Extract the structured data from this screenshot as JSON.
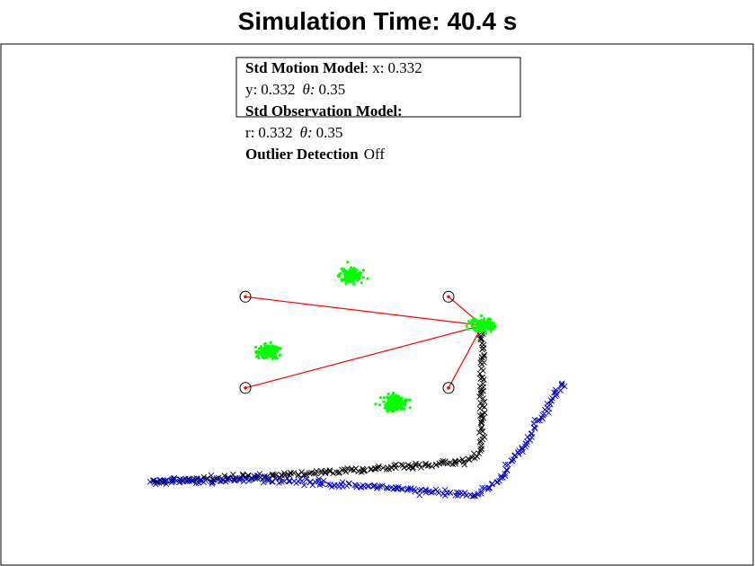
{
  "title": "Simulation Time: 40.4 s",
  "legend": {
    "motion_label": "Std Motion Model",
    "motion_x_prefix": ": x:",
    "motion_x": "0.332",
    "motion_y_prefix": "y:",
    "motion_y": "0.332",
    "motion_theta_prefix": "θ:",
    "motion_theta": "0.35",
    "observation_label": "Std Observation Model:",
    "obs_r_prefix": "r:",
    "obs_r": "0.332",
    "obs_theta_prefix": "θ:",
    "obs_theta": "0.35",
    "outlier_label": "Outlier Detection",
    "outlier_value": "Off"
  },
  "colors": {
    "estimate_path": "#000000",
    "true_path": "#0000cc",
    "particles": "#00ff00",
    "observation_lines": "#ff0000",
    "landmark_circle": "#000000",
    "landmark_dot": "#ff0000",
    "frame": "#000000"
  },
  "chart_data": {
    "type": "scatter",
    "title": "Simulation Time: 40.4 s",
    "xlabel": "",
    "ylabel": "",
    "xlim": [
      0,
      100
    ],
    "ylim": [
      0,
      100
    ],
    "grid": false,
    "legend_placement": "top-center",
    "landmarks": [
      {
        "x": 32.5,
        "y": 51.5
      },
      {
        "x": 59.5,
        "y": 51.5
      },
      {
        "x": 32.5,
        "y": 34.0
      },
      {
        "x": 59.5,
        "y": 34.0
      }
    ],
    "robot": {
      "x": 64.0,
      "y": 46.0
    },
    "particle_clusters": [
      {
        "x": 46.5,
        "y": 55.5
      },
      {
        "x": 64.0,
        "y": 46.0
      },
      {
        "x": 35.5,
        "y": 41.0
      },
      {
        "x": 52.5,
        "y": 31.0
      }
    ],
    "series": [
      {
        "x": [
          64.0,
          64.0,
          64.0,
          63.5,
          62.0,
          50.0,
          35.0,
          20.0
        ],
        "y": [
          46.0,
          35.0,
          25.0,
          21.5,
          20.0,
          18.5,
          17.0,
          16.0
        ]
      },
      {
        "x": [
          20.0,
          35.0,
          50.0,
          63.0,
          66.0,
          70.0,
          75.0
        ],
        "y": [
          16.0,
          16.5,
          15.0,
          13.5,
          16.0,
          24.0,
          35.5
        ]
      }
    ]
  }
}
